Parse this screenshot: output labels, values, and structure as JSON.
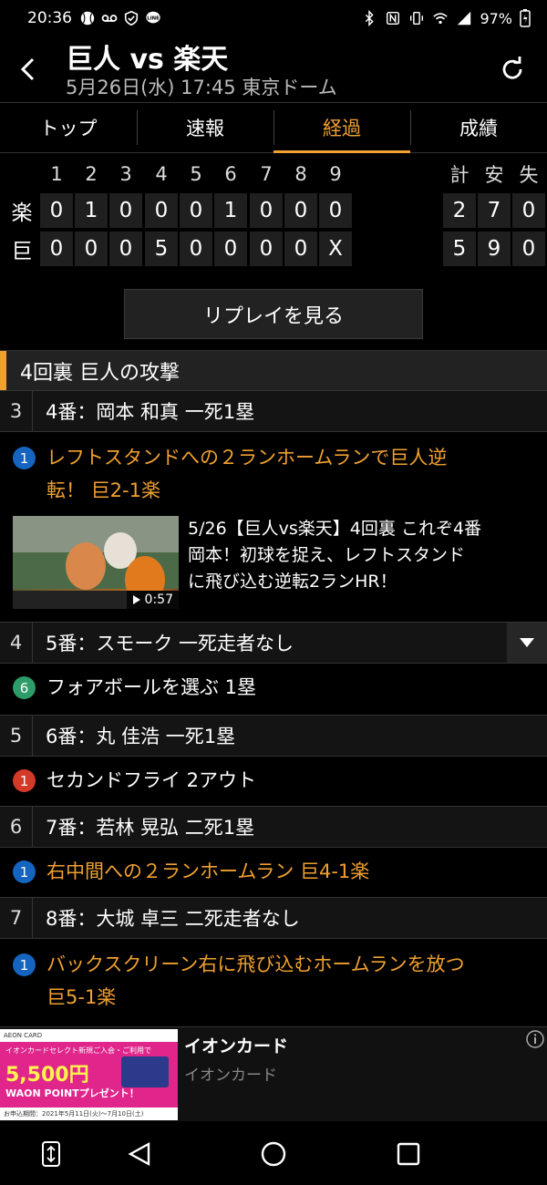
{
  "status_bar": {
    "time": "20:36",
    "battery": "97%"
  },
  "header": {
    "title": "巨人 vs 楽天",
    "subtitle": "5月26日(水) 17:45 東京ドーム"
  },
  "tabs": [
    {
      "label": "トップ",
      "active": false
    },
    {
      "label": "速報",
      "active": false
    },
    {
      "label": "経過",
      "active": true
    },
    {
      "label": "成績",
      "active": false
    }
  ],
  "scoreboard": {
    "innings": [
      "1",
      "2",
      "3",
      "4",
      "5",
      "6",
      "7",
      "8",
      "9"
    ],
    "totals_headers": [
      "計",
      "安",
      "失"
    ],
    "teams": [
      {
        "label": "楽",
        "scores": [
          "0",
          "1",
          "0",
          "0",
          "0",
          "1",
          "0",
          "0",
          "0"
        ],
        "totals": [
          "2",
          "7",
          "0"
        ]
      },
      {
        "label": "巨",
        "scores": [
          "0",
          "0",
          "0",
          "5",
          "0",
          "0",
          "0",
          "0",
          "X"
        ],
        "totals": [
          "5",
          "9",
          "0"
        ]
      }
    ]
  },
  "replay_button": "リプレイを見る",
  "section": {
    "title": "4回裏  巨人の攻撃"
  },
  "plays": [
    {
      "order": "3",
      "batter": "4番：岡本  和真  一死1塁"
    },
    {
      "badge": "1",
      "badge_color": "#1565c0",
      "text_lines": [
        "レフトスタンドへの２ランホームランで巨人逆",
        "転！  巨2-1楽"
      ]
    },
    {
      "order": "4",
      "batter": "5番：スモーク  一死走者なし"
    },
    {
      "badge": "6",
      "badge_color": "#2e9c6a",
      "text": "フォアボールを選ぶ  1塁"
    },
    {
      "order": "5",
      "batter": "6番：丸  佳浩  一死1塁"
    },
    {
      "badge": "1",
      "badge_color": "#d43a2a",
      "text": "セカンドフライ  2アウト"
    },
    {
      "order": "6",
      "batter": "7番：若林  晃弘  二死1塁"
    },
    {
      "badge": "1",
      "badge_color": "#1565c0",
      "text": "右中間への２ランホームラン  巨4-1楽"
    },
    {
      "order": "7",
      "batter": "8番：大城  卓三  二死走者なし"
    },
    {
      "badge": "1",
      "badge_color": "#1565c0",
      "text_lines": [
        "バックスクリーン右に飛び込むホームランを放つ",
        "巨5-1楽"
      ]
    }
  ],
  "video": {
    "duration": "0:57",
    "description_lines": [
      "5/26【巨人vs楽天】4回裏  これぞ4番",
      "岡本！初球を捉え、レフトスタンド",
      "に飛び込む逆転2ランHR！"
    ]
  },
  "ad": {
    "title": "イオンカード",
    "advertiser": "イオンカード",
    "image_brand": "AEON CARD",
    "image_headline": "イオンカードセレクト新規ご入会・ご利用で",
    "image_amount": "5,500円",
    "image_sub": "WAON POINTプレゼント！",
    "image_period": "お申込期間：2021年5月11日(火)〜7月10日(土)"
  },
  "colors": {
    "accent": "#f0a030",
    "badge_blue": "#1565c0",
    "badge_green": "#2e9c6a",
    "badge_red": "#d43a2a"
  }
}
